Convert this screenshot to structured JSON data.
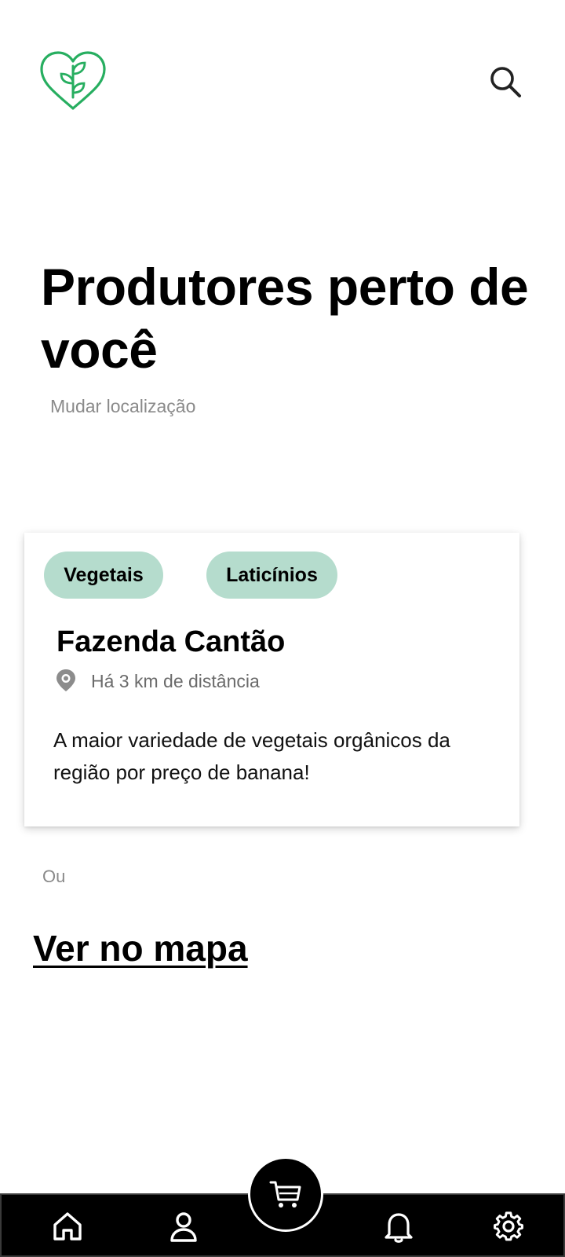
{
  "header": {
    "logo_icon": "heart-plant-logo-icon",
    "brand_color": "#27ae60",
    "search_icon": "search-icon"
  },
  "main": {
    "title": "Produtores perto de você",
    "change_location": "Mudar localização"
  },
  "producer_card": {
    "tags": [
      "Vegetais",
      "Laticínios"
    ],
    "tag_color": "#b5dccd",
    "name": "Fazenda Cantão",
    "distance": "Há 3 km de distância",
    "description": "A maior variedade de vegetais orgânicos da região por preço de banana!"
  },
  "alternative": {
    "or_label": "Ou",
    "map_link": "Ver no mapa"
  },
  "bottom_nav": {
    "items": [
      "home-icon",
      "profile-icon",
      "cart-icon",
      "bell-icon",
      "gear-icon"
    ]
  }
}
